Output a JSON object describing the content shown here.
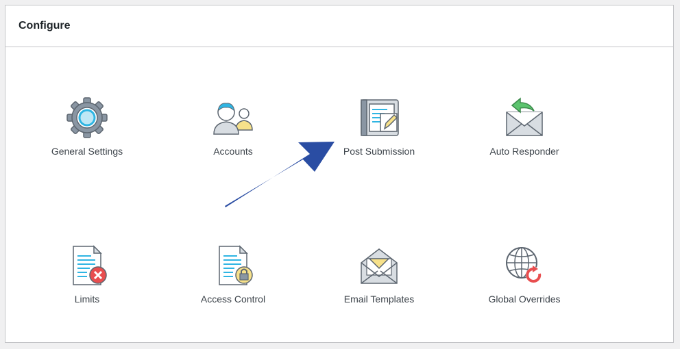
{
  "panel": {
    "title": "Configure"
  },
  "tiles": [
    {
      "label": "General Settings",
      "icon": "gear-icon"
    },
    {
      "label": "Accounts",
      "icon": "users-icon"
    },
    {
      "label": "Post Submission",
      "icon": "post-edit-icon"
    },
    {
      "label": "Auto Responder",
      "icon": "envelope-reply-icon"
    },
    {
      "label": "Limits",
      "icon": "document-limit-icon"
    },
    {
      "label": "Access Control",
      "icon": "document-lock-icon"
    },
    {
      "label": "Email Templates",
      "icon": "envelope-open-icon"
    },
    {
      "label": "Global Overrides",
      "icon": "globe-refresh-icon"
    }
  ],
  "colors": {
    "annotation_arrow": "#2a4da3",
    "icon_blue": "#2fb5e3",
    "icon_red": "#e84e4f",
    "icon_yellow": "#f7e18a",
    "icon_green": "#5cc46e"
  }
}
